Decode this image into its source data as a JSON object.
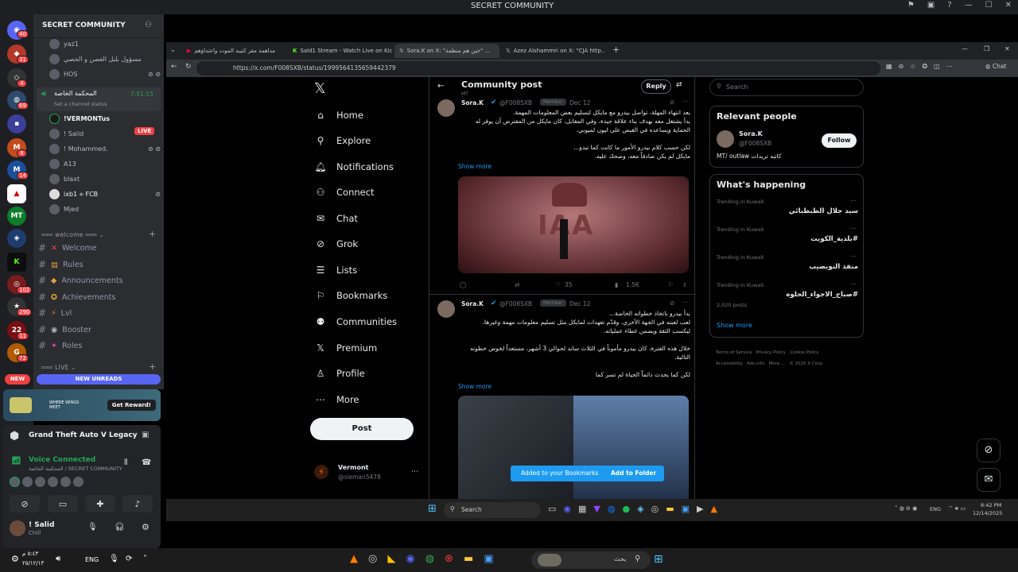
{
  "window": {
    "title": "SECRET COMMUNITY"
  },
  "server": {
    "name": "SECRET COMMUNITY"
  },
  "guild_badges": [
    "40",
    "31",
    "4",
    "69",
    "8",
    "14",
    "102",
    "290",
    "11",
    "72"
  ],
  "voice_top": [
    {
      "name": "yaz1"
    },
    {
      "name": "مسؤول بلبل الغصن و الحصي"
    },
    {
      "name": "HOS"
    }
  ],
  "voice_channel": {
    "name": "المحكمة الخاصة",
    "timer": "7:51:15",
    "status_placeholder": "Set a channel status"
  },
  "voice_users": [
    {
      "name": "!VERMONTus",
      "live": "LIVE"
    },
    {
      "name": "! Salid"
    },
    {
      "name": "! Mohammed."
    },
    {
      "name": "A13"
    },
    {
      "name": "blaxt"
    },
    {
      "name": "ixb1 ⟡ FCB"
    },
    {
      "name": "Mjed"
    }
  ],
  "categories": {
    "welcome": "welcome",
    "live": "LIVE"
  },
  "channels": [
    {
      "name": "Welcome",
      "emoji": "✕"
    },
    {
      "name": "Rules",
      "emoji": "▤"
    },
    {
      "name": "Announcements",
      "emoji": "◆"
    },
    {
      "name": "Achievements",
      "emoji": "✪"
    },
    {
      "name": "Lvl",
      "emoji": "⚡"
    },
    {
      "name": "Booster",
      "emoji": "◉"
    },
    {
      "name": "Roles",
      "emoji": "✦"
    }
  ],
  "unreads": {
    "new_pill": "NEW",
    "label": "NEW UNREADS"
  },
  "promo": {
    "tagline": "WHERE WINGS MEET",
    "button": "Get Reward!"
  },
  "activity": {
    "game": "Grand Theft Auto V Legacy"
  },
  "voice_connection": {
    "status": "Voice Connected",
    "location": "المحكمة الخاصة / SECRET COMMUNITY"
  },
  "user": {
    "name": "! Salid",
    "status": "Chill"
  },
  "browser": {
    "tabs": [
      {
        "title": "مداهمة مقر كتيبة الموت واعتداؤهم"
      },
      {
        "title": "Sald1 Stream - Watch Live on Kick"
      },
      {
        "title": "Sora.K on X: \"حين هم منظمة\" ..."
      },
      {
        "title": "Azez Alshammri on X: \"CJA http..."
      }
    ],
    "url": "https://x.com/F008SXB/status/1999564135659442379"
  },
  "x_nav": [
    {
      "label": "Home",
      "icon": "home-icon"
    },
    {
      "label": "Explore",
      "icon": "search-icon"
    },
    {
      "label": "Notifications",
      "icon": "bell-icon"
    },
    {
      "label": "Connect",
      "icon": "person-add-icon"
    },
    {
      "label": "Chat",
      "icon": "mail-icon"
    },
    {
      "label": "Grok",
      "icon": "grok-icon"
    },
    {
      "label": "Lists",
      "icon": "list-icon"
    },
    {
      "label": "Bookmarks",
      "icon": "bookmark-icon"
    },
    {
      "label": "Communities",
      "icon": "people-icon"
    },
    {
      "label": "Premium",
      "icon": "x-icon"
    },
    {
      "label": "Profile",
      "icon": "person-icon"
    },
    {
      "label": "More",
      "icon": "more-icon"
    }
  ],
  "post_button": "Post",
  "account": {
    "name": "Vermont",
    "handle": "@sleman5478"
  },
  "header": {
    "title": "Community post",
    "subtitle": "MT",
    "reply": "Reply"
  },
  "tweets": [
    {
      "author": "Sora.K",
      "handle": "@F008SXB",
      "badge": "Member",
      "date": "Dec 12",
      "lines": [
        "بعد انتهاء المهلة، تواصل بيدرو مع مايكل لتسليم بعض المعلومات المهمة.",
        "بدأ يشتغل معه بهدف بناء علاقة جيدة، وفي المقابل، كان مايكل من المفترض أن يوفر له",
        "الحماية ويساعده في القبض على ليون لميوني.",
        "",
        "لكن حسب كلام بيدرو الأمور ما كانت كما تبدو...",
        "مايكل لم يكن صادقاً معه، وضحك عليه."
      ],
      "show_more": "Show more",
      "image_text": "IAA",
      "stats": {
        "likes": "35",
        "views": "1.5K"
      }
    },
    {
      "author": "Sora.K",
      "handle": "@F008SXB",
      "badge": "Member",
      "date": "Dec 12",
      "lines": [
        "بدأ بيدرو باتخاذ خطواته الخاصة...",
        "لعب لعبته في الجهة الأخرى، وقدّم تعهدات لمايكل مثل تسليم معلومات مهمة وغيرها،",
        "ليكسب الثقة ويضمن غطاء عملياته.",
        "",
        "خلال هذه الفترة، كان بيدرو مأموناً في الثلاث ساند لحوالي 3 أشهر، مستعداً لخوض خطوته",
        "التالية.",
        "",
        "لكن كما يحدث دائماً الحياة لم تسر كما"
      ],
      "show_more": "Show more"
    }
  ],
  "toast": {
    "message": "Added to your Bookmarks",
    "action": "Add to Folder"
  },
  "search": {
    "placeholder": "Search"
  },
  "relevant": {
    "title": "Relevant people",
    "name": "Sora.K",
    "handle": "@F008SXB",
    "bio": "كاتبه تريدات MT/ outlaw",
    "follow": "Follow"
  },
  "happening": {
    "title": "What's happening",
    "items": [
      {
        "context": "Trending in Kuwait",
        "topic": "سيد جلال الطبطبائي"
      },
      {
        "context": "Trending in Kuwait",
        "topic": "#بلدية_الكويت"
      },
      {
        "context": "Trending in Kuwait",
        "topic": "منفذ النويصيب"
      },
      {
        "context": "Trending in Kuwait",
        "topic": "#صباح_الاجواء_الحلوه",
        "posts": "2,020 posts"
      }
    ],
    "show_more": "Show more"
  },
  "footer_links": [
    "Terms of Service",
    "Privacy Policy",
    "Cookie Policy",
    "Accessibility",
    "Ads info",
    "More ...",
    "© 2025 X Corp."
  ],
  "inner_taskbar": {
    "search": "Search",
    "lang": "ENG",
    "time": "8:42 PM",
    "date": "12/14/2025"
  },
  "outer_taskbar": {
    "lang": "ENG",
    "time": "٥:٤٣ م",
    "date": "٢٥/١٢/١٣",
    "search": "بحث"
  }
}
